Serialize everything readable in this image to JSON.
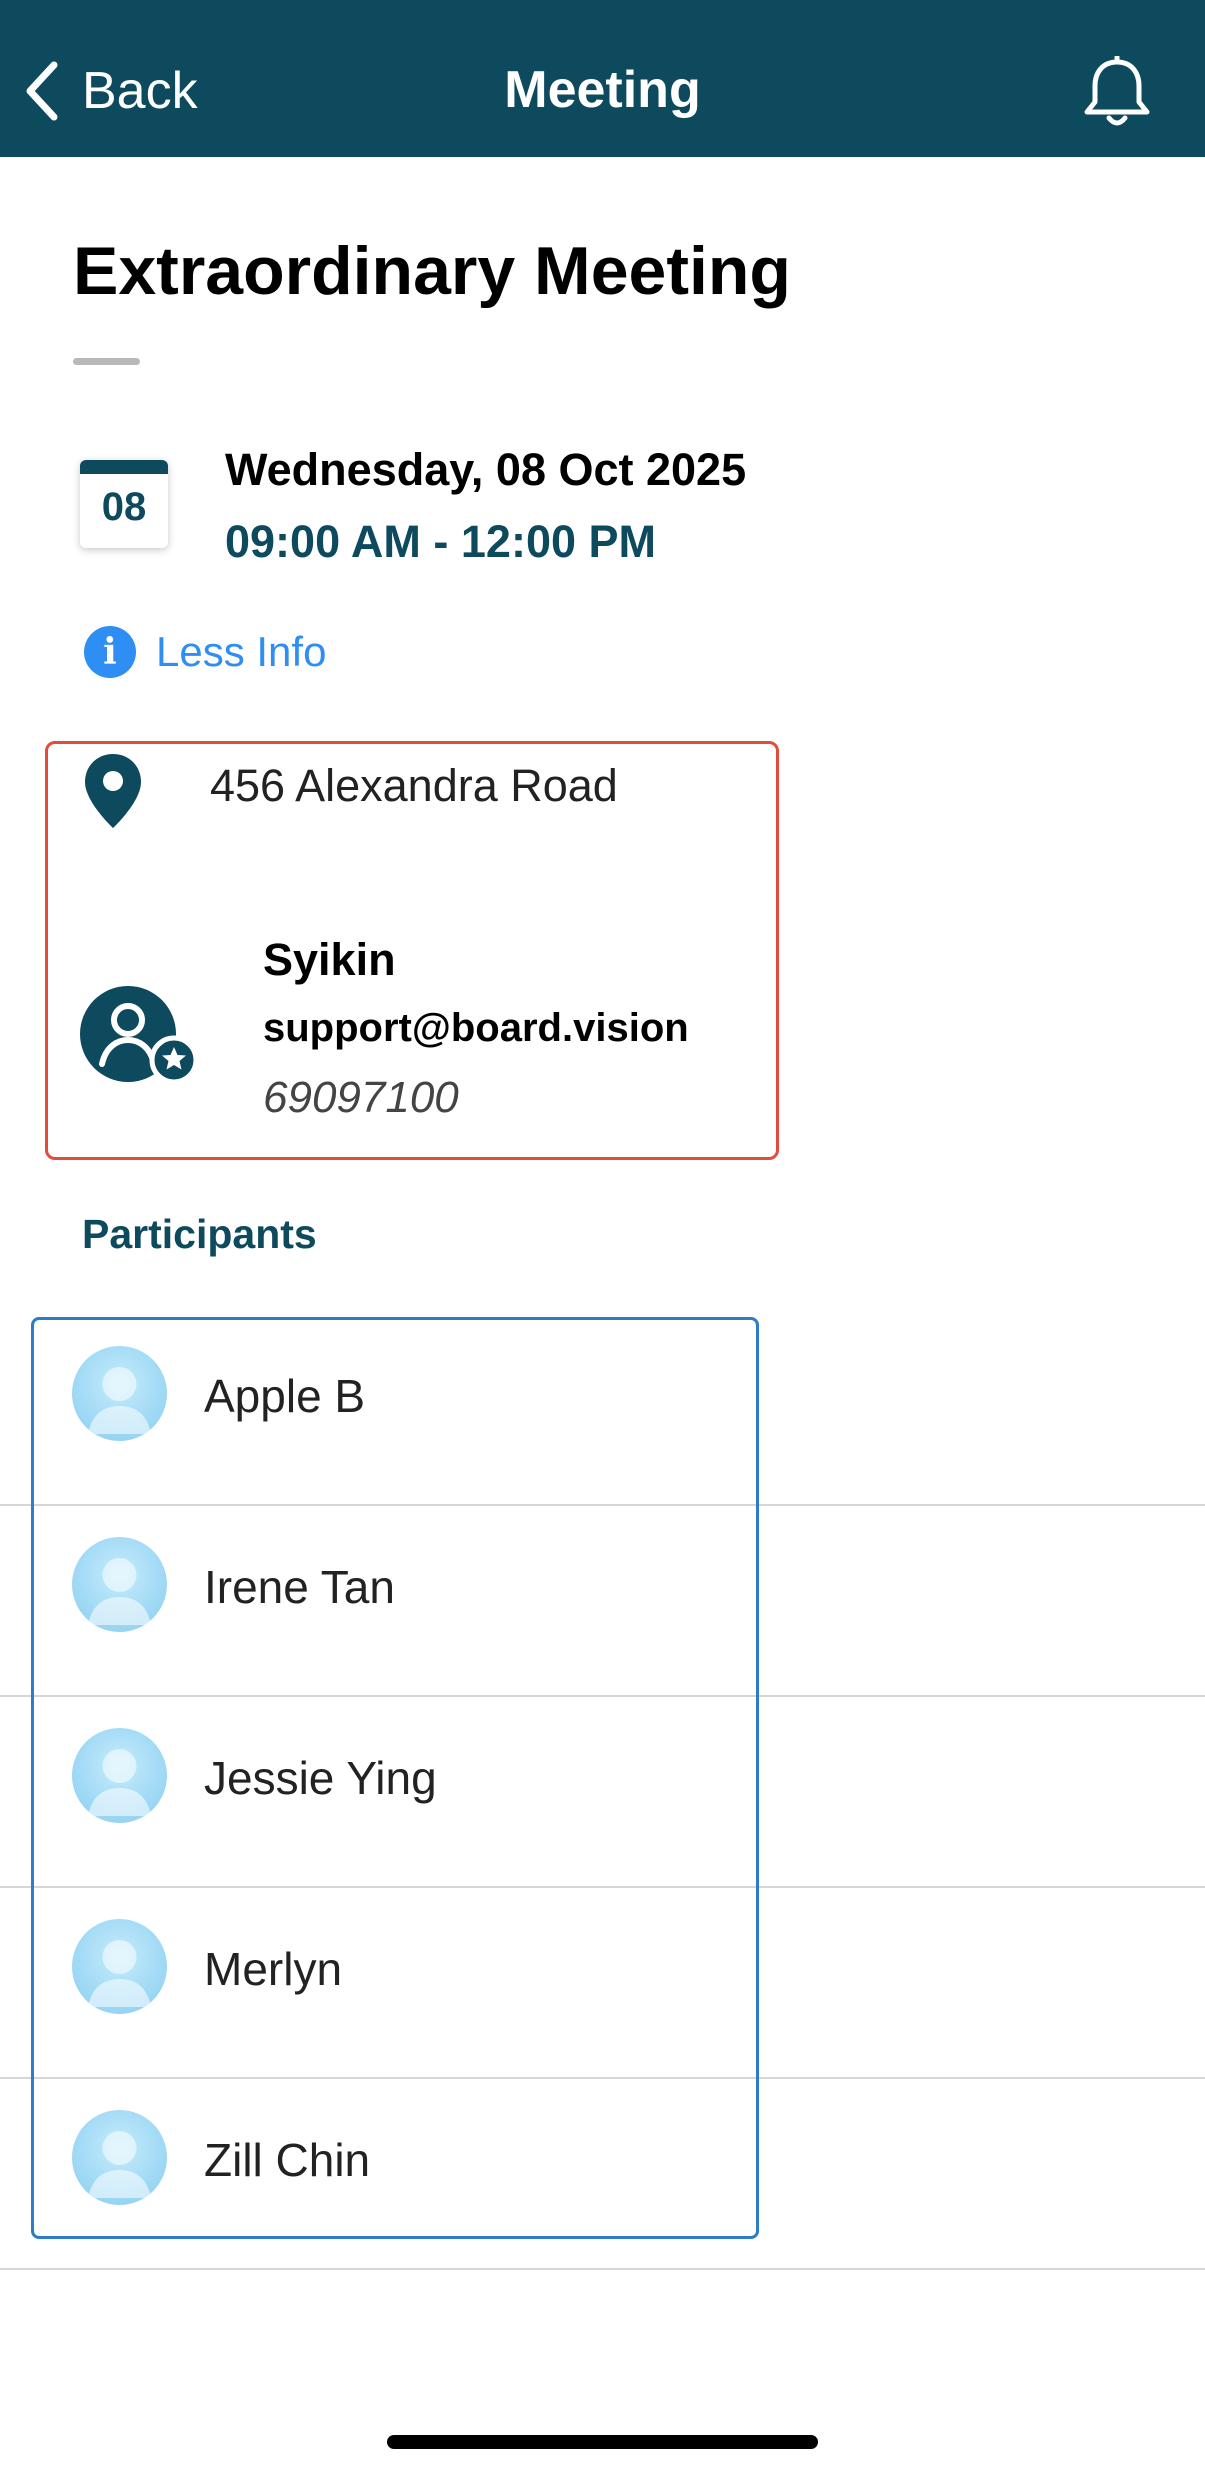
{
  "header": {
    "back_label": "Back",
    "title": "Meeting",
    "bar_color": "#0e4a5e",
    "back_icon": "chevron-left-icon",
    "notification_icon": "bell-icon"
  },
  "meeting": {
    "title": "Extraordinary Meeting",
    "calendar_day": "08",
    "date": "Wednesday, 08 Oct 2025",
    "time": "09:00 AM - 12:00 PM"
  },
  "info_toggle": {
    "icon": "info-icon",
    "label": "Less Info",
    "color": "#2f8ef4"
  },
  "details": {
    "border_color": "#e24c3d",
    "location_icon": "map-pin-icon",
    "address": "456 Alexandra Road",
    "contact_icon": "user-star-icon",
    "contact_name": "Syikin",
    "contact_email": "support@board.vision",
    "contact_phone": "69097100"
  },
  "participants": {
    "label": "Participants",
    "border_color": "#2c7cc6",
    "items": [
      {
        "name": "Apple B"
      },
      {
        "name": "Irene Tan"
      },
      {
        "name": "Jessie Ying"
      },
      {
        "name": "Merlyn"
      },
      {
        "name": "Zill Chin"
      }
    ]
  }
}
